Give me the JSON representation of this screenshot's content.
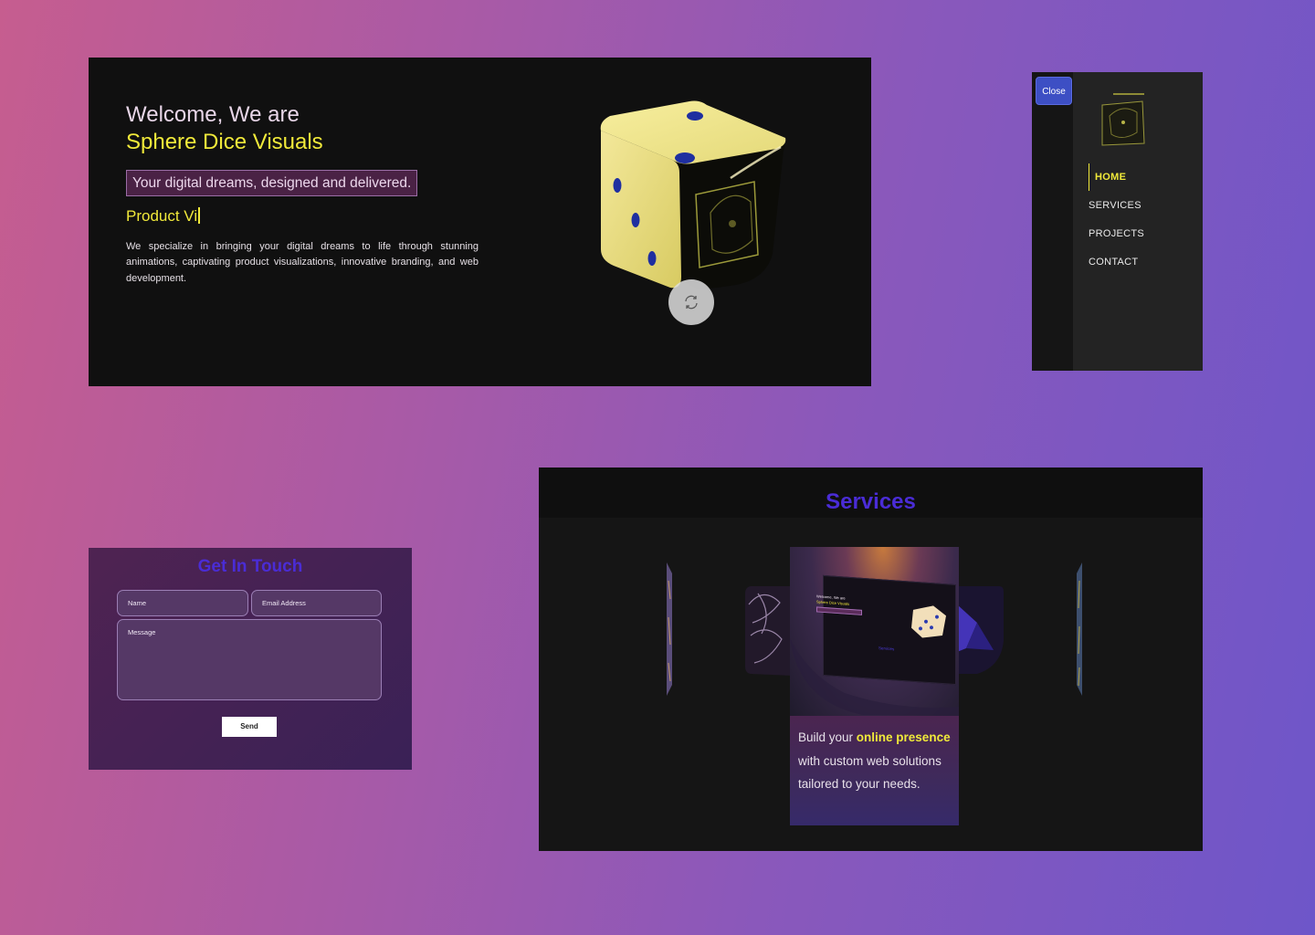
{
  "hero": {
    "welcome": "Welcome, We are",
    "brand": "Sphere Dice Visuals",
    "tagline": "Your digital dreams, designed and delivered.",
    "typed_text": "Product Vi",
    "description": "We specialize in bringing your digital dreams to life through stunning animations, captivating product visualizations, innovative branding, and web development."
  },
  "menu": {
    "close_label": "Close",
    "items": [
      {
        "label": "HOME",
        "active": true
      },
      {
        "label": "SERVICES",
        "active": false
      },
      {
        "label": "PROJECTS",
        "active": false
      },
      {
        "label": "CONTACT",
        "active": false
      }
    ]
  },
  "contact": {
    "title": "Get In Touch",
    "name_placeholder": "Name",
    "email_placeholder": "Email Address",
    "message_placeholder": "Message",
    "send_label": "Send"
  },
  "services": {
    "title": "Services",
    "card_text": {
      "before": "Build your ",
      "highlight": "online presence",
      "after": " with custom web solutions tailored to your needs."
    },
    "mini_preview": {
      "welcome": "Welcome, We are",
      "brand": "Sphere Dice Visuals",
      "nav_label": "Services"
    }
  },
  "colors": {
    "accent_yellow": "#f0e93a",
    "heading_blue": "#4a2cd6",
    "close_button": "#3d4fc4",
    "panel_dark": "#101010"
  }
}
